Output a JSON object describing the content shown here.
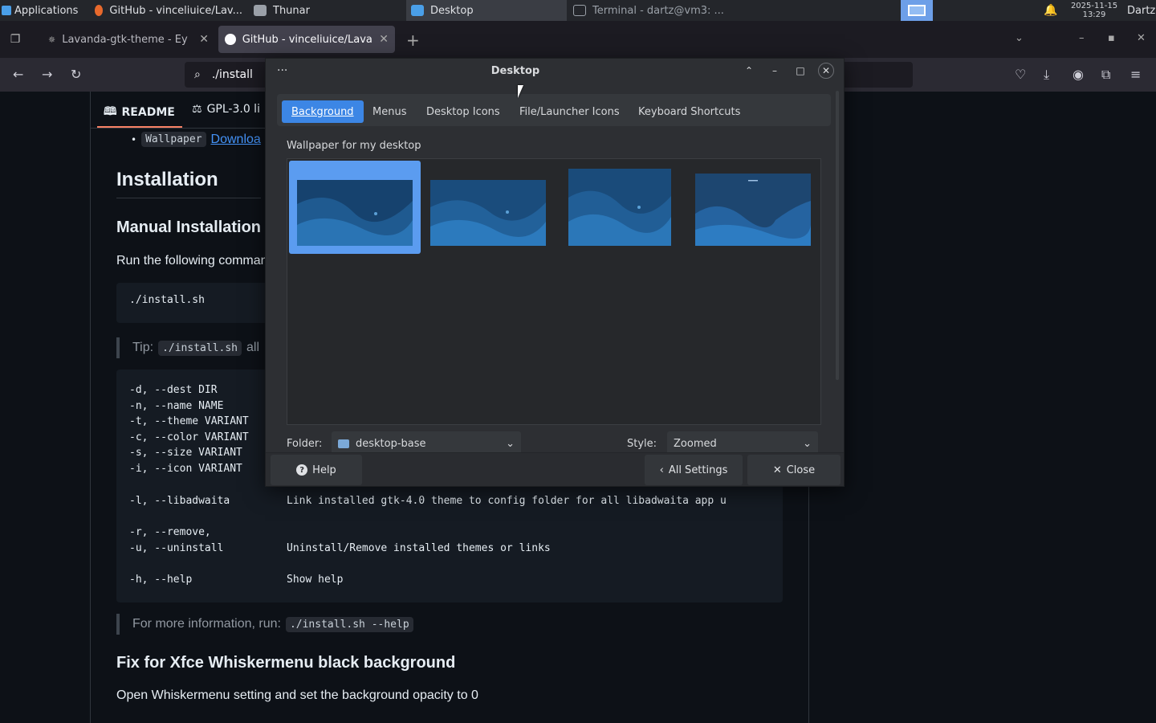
{
  "panel": {
    "applications_label": "Applications",
    "tasks": [
      {
        "label": "GitHub - vinceliuice/Lav..."
      },
      {
        "label": "Thunar"
      },
      {
        "label": "Desktop"
      },
      {
        "label": "Terminal - dartz@vm3: ..."
      }
    ],
    "clock_date": "2025-11-15",
    "clock_time": "13:29",
    "user": "Dartz"
  },
  "browser": {
    "tabs": [
      {
        "title": "Lavanda-gtk-theme - Ey"
      },
      {
        "title": "GitHub - vinceliuice/Lava"
      }
    ],
    "new_tab": "+",
    "url": "./install"
  },
  "page": {
    "readme_tabs": [
      "README",
      "GPL-3.0 li"
    ],
    "wallpaper_item": "Wallpaper",
    "download_link": "Downloa",
    "installation_heading": "Installation",
    "manual_heading": "Manual Installation",
    "run_text": "Run the following comman",
    "install_cmd": "./install.sh",
    "tip_label": "Tip:",
    "tip_code": "./install.sh",
    "tip_rest": "all",
    "options": [
      {
        "flag": "-d, --dest DIR",
        "desc": ""
      },
      {
        "flag": "-n, --name NAME",
        "desc": ""
      },
      {
        "flag": "-t, --theme VARIANT",
        "desc": ""
      },
      {
        "flag": "-c, --color VARIANT",
        "desc": ""
      },
      {
        "flag": "-s, --size VARIANT",
        "desc": ""
      },
      {
        "flag": "-i, --icon VARIANT",
        "desc": ""
      },
      {
        "flag": "-l, --libadwaita",
        "desc": "Link installed gtk-4.0 theme to config folder for all libadwaita app u"
      },
      {
        "flag": "-r, --remove,",
        "desc": ""
      },
      {
        "flag": "-u, --uninstall",
        "desc": "Uninstall/Remove installed themes or links"
      },
      {
        "flag": "-h, --help",
        "desc": "Show help"
      }
    ],
    "more_info_text": "For more information, run:",
    "more_info_code": "./install.sh --help",
    "whisker_heading": "Fix for Xfce Whiskermenu black background",
    "whisker_text": "Open Whiskermenu setting and set the background opacity to 0"
  },
  "dialog": {
    "menu_glyph": "···",
    "title": "Desktop",
    "tabs": [
      "Background",
      "Menus",
      "Desktop Icons",
      "File/Launcher Icons",
      "Keyboard Shortcuts"
    ],
    "wallpaper_label": "Wallpaper for my desktop",
    "folder_label": "Folder:",
    "folder_value": "desktop-base",
    "style_label": "Style:",
    "style_value": "Zoomed",
    "help_button": "Help",
    "all_settings_button": "All Settings",
    "close_button": "Close"
  },
  "colors": {
    "accent": "#3c86e5",
    "page_bg": "#0d1117",
    "link": "#4493f8"
  }
}
